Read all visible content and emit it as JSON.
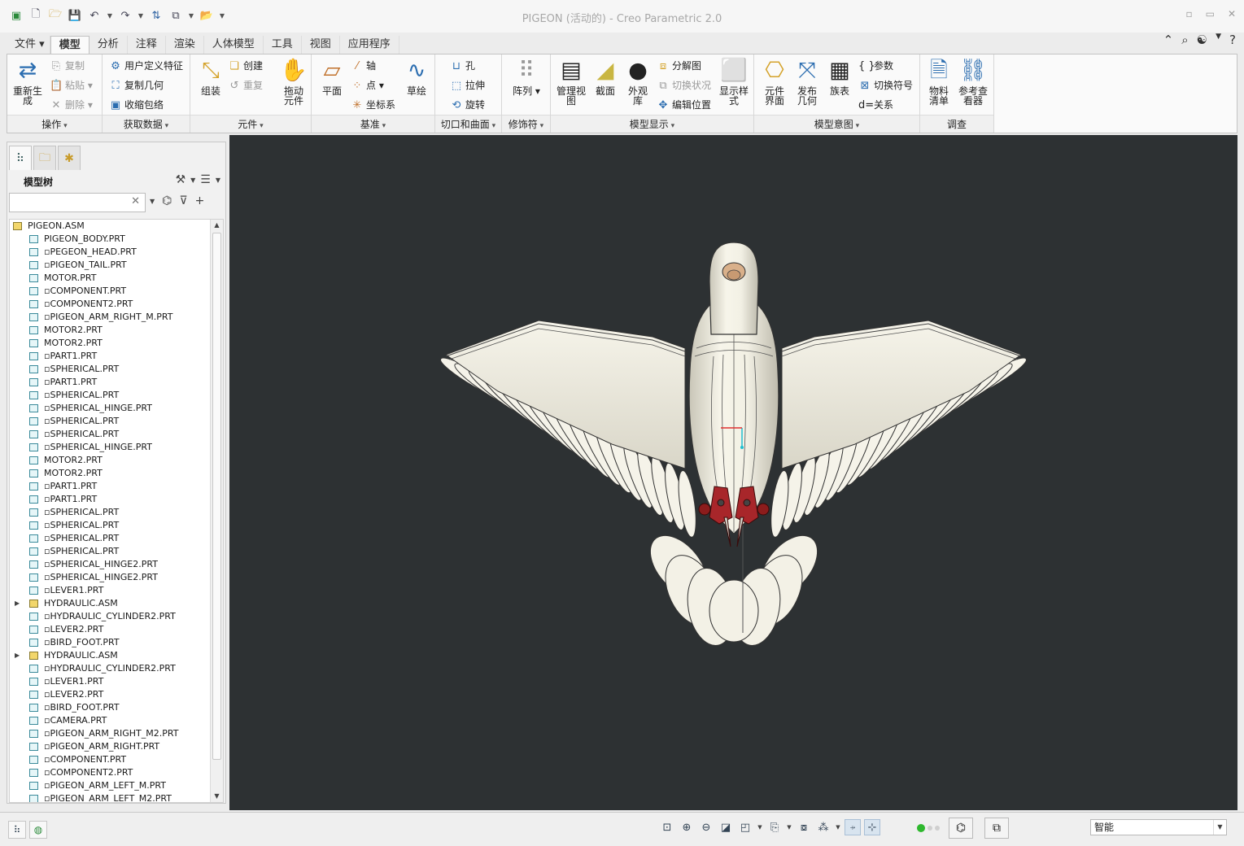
{
  "window": {
    "title": "PIGEON (活动的) - Creo Parametric 2.0",
    "controls": [
      "▫",
      "▭",
      "✕"
    ]
  },
  "quick_access": [
    "新建",
    "打开",
    "保存",
    "撤消",
    "重做",
    "重新生成",
    "窗口",
    "关闭"
  ],
  "tabs": [
    "文件",
    "模型",
    "分析",
    "注释",
    "渲染",
    "人体模型",
    "工具",
    "视图",
    "应用程序"
  ],
  "active_tab": "模型",
  "ribbon": {
    "operations": {
      "label": "操作",
      "regenerate": "重新生\n成",
      "copy": "复制",
      "paste": "粘贴",
      "delete": "删除"
    },
    "get_data": {
      "label": "获取数据",
      "user_feature": "用户定义特征",
      "copy_geometry": "复制几何",
      "shrinkwrap": "收缩包络"
    },
    "component": {
      "label": "元件",
      "assemble": "组装",
      "create": "创建",
      "repeat": "重复",
      "drag": "拖动\n元件"
    },
    "datum": {
      "label": "基准",
      "plane": "平面",
      "axis": "轴",
      "point": "点",
      "csys": "坐标系",
      "sketch": "草绘"
    },
    "cut_surface": {
      "label": "切口和曲面",
      "hole": "孔",
      "extrude": "拉伸",
      "revolve": "旋转"
    },
    "modifiers": {
      "label": "修饰符",
      "pattern": "阵列"
    },
    "model_display": {
      "label": "模型显示",
      "manage_views": "管理视\n图",
      "section": "截面",
      "appearance": "外观\n库",
      "exploded": "分解图",
      "toggle_status": "切换状况",
      "edit_position": "编辑位置",
      "display_style": "显示样\n式"
    },
    "model_intent": {
      "label": "模型意图",
      "component_interface": "元件\n界面",
      "publish_geometry": "发布\n几何",
      "family_table": "族表",
      "parameters": "参数",
      "toggle_symbols": "切换符号",
      "relations": "关系"
    },
    "investigate": {
      "label": "调查",
      "bom": "物料\n清单",
      "reference_viewer": "参考查\n看器"
    }
  },
  "model_tree": {
    "title": "模型树",
    "search_placeholder": "",
    "items": [
      {
        "name": "PIGEON.ASM",
        "type": "asm",
        "level": 0,
        "expandable": false
      },
      {
        "name": "PIGEON_BODY.PRT",
        "type": "prt",
        "level": 1,
        "expandable": false
      },
      {
        "name": "▫PEGEON_HEAD.PRT",
        "type": "prt",
        "level": 1,
        "expandable": false
      },
      {
        "name": "▫PIGEON_TAIL.PRT",
        "type": "prt",
        "level": 1,
        "expandable": false
      },
      {
        "name": "MOTOR.PRT",
        "type": "prt",
        "level": 1,
        "expandable": false
      },
      {
        "name": "▫COMPONENT.PRT",
        "type": "prt",
        "level": 1,
        "expandable": false
      },
      {
        "name": "▫COMPONENT2.PRT",
        "type": "prt",
        "level": 1,
        "expandable": false
      },
      {
        "name": "▫PIGEON_ARM_RIGHT_M.PRT",
        "type": "prt",
        "level": 1,
        "expandable": false
      },
      {
        "name": "MOTOR2.PRT",
        "type": "prt",
        "level": 1,
        "expandable": false
      },
      {
        "name": "MOTOR2.PRT",
        "type": "prt",
        "level": 1,
        "expandable": false
      },
      {
        "name": "▫PART1.PRT",
        "type": "prt",
        "level": 1,
        "expandable": false
      },
      {
        "name": "▫SPHERICAL.PRT",
        "type": "prt",
        "level": 1,
        "expandable": false
      },
      {
        "name": "▫PART1.PRT",
        "type": "prt",
        "level": 1,
        "expandable": false
      },
      {
        "name": "▫SPHERICAL.PRT",
        "type": "prt",
        "level": 1,
        "expandable": false
      },
      {
        "name": "▫SPHERICAL_HINGE.PRT",
        "type": "prt",
        "level": 1,
        "expandable": false
      },
      {
        "name": "▫SPHERICAL.PRT",
        "type": "prt",
        "level": 1,
        "expandable": false
      },
      {
        "name": "▫SPHERICAL.PRT",
        "type": "prt",
        "level": 1,
        "expandable": false
      },
      {
        "name": "▫SPHERICAL_HINGE.PRT",
        "type": "prt",
        "level": 1,
        "expandable": false
      },
      {
        "name": "MOTOR2.PRT",
        "type": "prt",
        "level": 1,
        "expandable": false
      },
      {
        "name": "MOTOR2.PRT",
        "type": "prt",
        "level": 1,
        "expandable": false
      },
      {
        "name": "▫PART1.PRT",
        "type": "prt",
        "level": 1,
        "expandable": false
      },
      {
        "name": "▫PART1.PRT",
        "type": "prt",
        "level": 1,
        "expandable": false
      },
      {
        "name": "▫SPHERICAL.PRT",
        "type": "prt",
        "level": 1,
        "expandable": false
      },
      {
        "name": "▫SPHERICAL.PRT",
        "type": "prt",
        "level": 1,
        "expandable": false
      },
      {
        "name": "▫SPHERICAL.PRT",
        "type": "prt",
        "level": 1,
        "expandable": false
      },
      {
        "name": "▫SPHERICAL.PRT",
        "type": "prt",
        "level": 1,
        "expandable": false
      },
      {
        "name": "▫SPHERICAL_HINGE2.PRT",
        "type": "prt",
        "level": 1,
        "expandable": false
      },
      {
        "name": "▫SPHERICAL_HINGE2.PRT",
        "type": "prt",
        "level": 1,
        "expandable": false
      },
      {
        "name": "▫LEVER1.PRT",
        "type": "prt",
        "level": 1,
        "expandable": false
      },
      {
        "name": "HYDRAULIC.ASM",
        "type": "asm",
        "level": 1,
        "expandable": true
      },
      {
        "name": "▫HYDRAULIC_CYLINDER2.PRT",
        "type": "prt",
        "level": 1,
        "expandable": false
      },
      {
        "name": "▫LEVER2.PRT",
        "type": "prt",
        "level": 1,
        "expandable": false
      },
      {
        "name": "▫BIRD_FOOT.PRT",
        "type": "prt",
        "level": 1,
        "expandable": false
      },
      {
        "name": "HYDRAULIC.ASM",
        "type": "asm",
        "level": 1,
        "expandable": true
      },
      {
        "name": "▫HYDRAULIC_CYLINDER2.PRT",
        "type": "prt",
        "level": 1,
        "expandable": false
      },
      {
        "name": "▫LEVER1.PRT",
        "type": "prt",
        "level": 1,
        "expandable": false
      },
      {
        "name": "▫LEVER2.PRT",
        "type": "prt",
        "level": 1,
        "expandable": false
      },
      {
        "name": "▫BIRD_FOOT.PRT",
        "type": "prt",
        "level": 1,
        "expandable": false
      },
      {
        "name": "▫CAMERA.PRT",
        "type": "prt",
        "level": 1,
        "expandable": false
      },
      {
        "name": "▫PIGEON_ARM_RIGHT_M2.PRT",
        "type": "prt",
        "level": 1,
        "expandable": false
      },
      {
        "name": "▫PIGEON_ARM_RIGHT.PRT",
        "type": "prt",
        "level": 1,
        "expandable": false
      },
      {
        "name": "▫COMPONENT.PRT",
        "type": "prt",
        "level": 1,
        "expandable": false
      },
      {
        "name": "▫COMPONENT2.PRT",
        "type": "prt",
        "level": 1,
        "expandable": false
      },
      {
        "name": "▫PIGEON_ARM_LEFT_M.PRT",
        "type": "prt",
        "level": 1,
        "expandable": false
      },
      {
        "name": "▫PIGEON_ARM_LEFT_M2.PRT",
        "type": "prt",
        "level": 1,
        "expandable": false
      }
    ]
  },
  "status_bar": {
    "filter_value": "智能"
  },
  "colors": {
    "viewport_bg": "#2d3133",
    "model_white": "#f4f2e8",
    "model_edge": "#2a2a2a",
    "joint_red": "#a02020"
  }
}
